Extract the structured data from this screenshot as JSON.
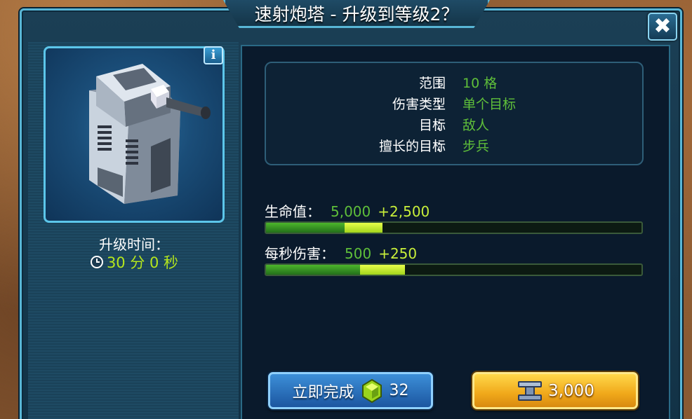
{
  "dialog": {
    "title": "速射炮塔 - 升级到等级2？",
    "close_icon": "close-icon"
  },
  "left": {
    "info_label": "i",
    "upgrade_time_label": "升级时间：",
    "upgrade_time_value": "30 分 0 秒",
    "clock_icon": "clock-icon"
  },
  "stats": [
    {
      "label": "范围",
      "colon": "：",
      "value": "10 格"
    },
    {
      "label": "伤害类型",
      "colon": "：",
      "value": "单个目标"
    },
    {
      "label": "目标",
      "colon": "：",
      "value": "敌人"
    },
    {
      "label": "擅长的目标",
      "colon": "：",
      "value": "步兵"
    }
  ],
  "bars": [
    {
      "label": "生命值：",
      "value": "5,000",
      "bonus": "+2,500",
      "fill": 0.21,
      "bonus_fill": 0.1
    },
    {
      "label": "每秒伤害：",
      "value": "500",
      "bonus": "+250",
      "fill": 0.25,
      "bonus_fill": 0.12
    }
  ],
  "buttons": {
    "finish_now": "立即完成",
    "gem_cost": "32",
    "resource_cost": "3,000",
    "gem_icon": "gem-icon",
    "resource_icon": "steel-icon"
  },
  "colors": {
    "accent": "#58b6d6",
    "stat_value": "#5fbf3a",
    "bonus": "#c8ef3a",
    "gold": "#f0a81a"
  }
}
